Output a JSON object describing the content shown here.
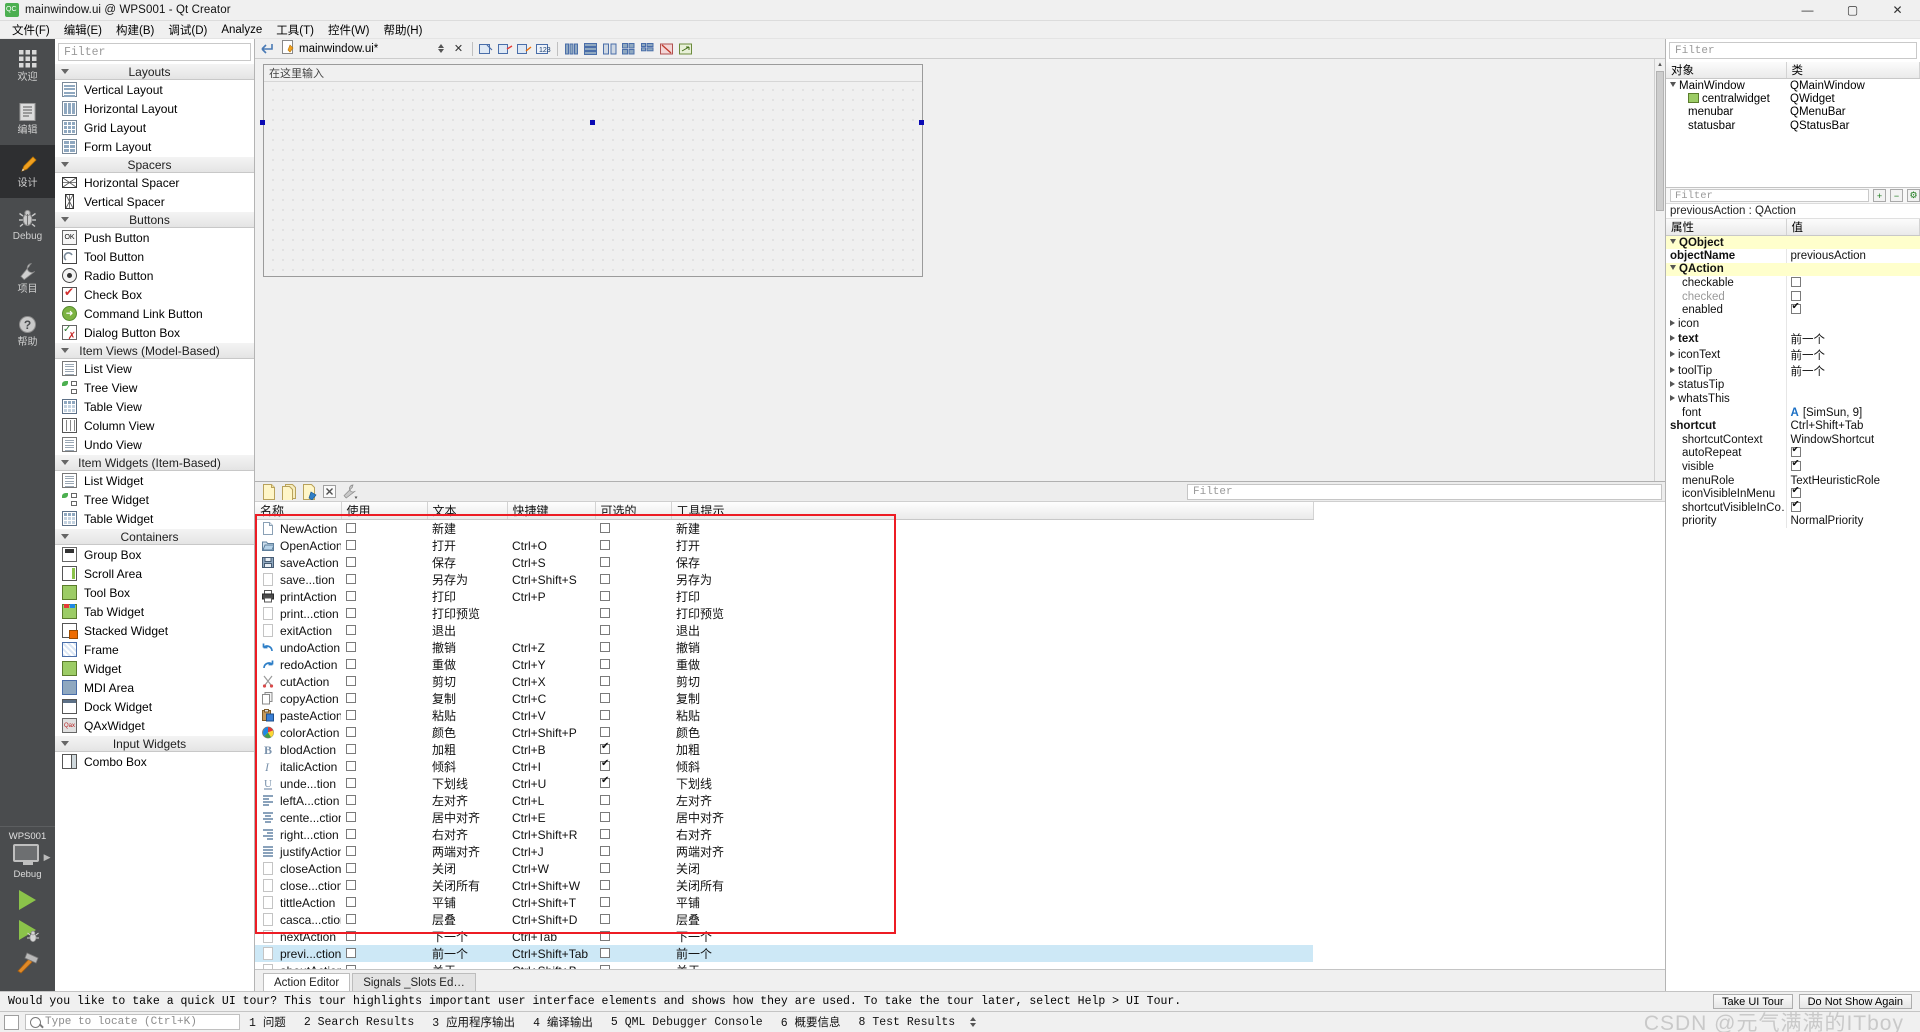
{
  "window": {
    "title": "mainwindow.ui @ WPS001 - Qt Creator",
    "app_icon": "qt-creator-icon",
    "minimize": "—",
    "maximize": "▢",
    "close": "✕"
  },
  "menubar": {
    "items": [
      {
        "label": "文件(F)",
        "name": "menu-file"
      },
      {
        "label": "编辑(E)",
        "name": "menu-edit"
      },
      {
        "label": "构建(B)",
        "name": "menu-build"
      },
      {
        "label": "调试(D)",
        "name": "menu-debug"
      },
      {
        "label": "Analyze",
        "name": "menu-analyze"
      },
      {
        "label": "工具(T)",
        "name": "menu-tools"
      },
      {
        "label": "控件(W)",
        "name": "menu-window"
      },
      {
        "label": "帮助(H)",
        "name": "menu-help"
      }
    ]
  },
  "modebar": {
    "modes": [
      {
        "label": "欢迎",
        "icon": "grid-icon",
        "active": false
      },
      {
        "label": "编辑",
        "icon": "document-icon",
        "active": false
      },
      {
        "label": "设计",
        "icon": "pencil-icon",
        "active": true
      },
      {
        "label": "Debug",
        "icon": "bug-icon",
        "active": false
      },
      {
        "label": "项目",
        "icon": "wrench-icon",
        "active": false
      },
      {
        "label": "帮助",
        "icon": "question-icon",
        "active": false
      }
    ],
    "kit": {
      "project_name": "WPS001",
      "build_config": "Debug",
      "monitor_icon": "desktop-icon"
    },
    "run_buttons": [
      {
        "name": "run-button",
        "icon": "play-icon"
      },
      {
        "name": "debug-button",
        "icon": "play-bug-icon"
      },
      {
        "name": "build-button",
        "icon": "hammer-icon"
      }
    ]
  },
  "widgetbox": {
    "filter_placeholder": "Filter",
    "groups": [
      {
        "name": "Layouts",
        "items": [
          {
            "label": "Vertical Layout",
            "icon": "vertical-layout-icon"
          },
          {
            "label": "Horizontal Layout",
            "icon": "horizontal-layout-icon"
          },
          {
            "label": "Grid Layout",
            "icon": "grid-layout-icon"
          },
          {
            "label": "Form Layout",
            "icon": "form-layout-icon"
          }
        ]
      },
      {
        "name": "Spacers",
        "items": [
          {
            "label": "Horizontal Spacer",
            "icon": "horizontal-spacer-icon"
          },
          {
            "label": "Vertical Spacer",
            "icon": "vertical-spacer-icon"
          }
        ]
      },
      {
        "name": "Buttons",
        "items": [
          {
            "label": "Push Button",
            "icon": "push-button-icon"
          },
          {
            "label": "Tool Button",
            "icon": "tool-button-icon"
          },
          {
            "label": "Radio Button",
            "icon": "radio-button-icon"
          },
          {
            "label": "Check Box",
            "icon": "check-box-icon"
          },
          {
            "label": "Command Link Button",
            "icon": "command-link-icon"
          },
          {
            "label": "Dialog Button Box",
            "icon": "dialog-button-box-icon"
          }
        ]
      },
      {
        "name": "Item Views (Model-Based)",
        "items": [
          {
            "label": "List View",
            "icon": "list-view-icon"
          },
          {
            "label": "Tree View",
            "icon": "tree-view-icon"
          },
          {
            "label": "Table View",
            "icon": "table-view-icon"
          },
          {
            "label": "Column View",
            "icon": "column-view-icon"
          },
          {
            "label": "Undo View",
            "icon": "undo-view-icon"
          }
        ]
      },
      {
        "name": "Item Widgets (Item-Based)",
        "items": [
          {
            "label": "List Widget",
            "icon": "list-widget-icon"
          },
          {
            "label": "Tree Widget",
            "icon": "tree-widget-icon"
          },
          {
            "label": "Table Widget",
            "icon": "table-widget-icon"
          }
        ]
      },
      {
        "name": "Containers",
        "items": [
          {
            "label": "Group Box",
            "icon": "group-box-icon"
          },
          {
            "label": "Scroll Area",
            "icon": "scroll-area-icon"
          },
          {
            "label": "Tool Box",
            "icon": "tool-box-icon"
          },
          {
            "label": "Tab Widget",
            "icon": "tab-widget-icon"
          },
          {
            "label": "Stacked Widget",
            "icon": "stacked-widget-icon"
          },
          {
            "label": "Frame",
            "icon": "frame-icon"
          },
          {
            "label": "Widget",
            "icon": "widget-icon"
          },
          {
            "label": "MDI Area",
            "icon": "mdi-area-icon"
          },
          {
            "label": "Dock Widget",
            "icon": "dock-widget-icon"
          },
          {
            "label": "QAxWidget",
            "icon": "qax-widget-icon"
          }
        ]
      },
      {
        "name": "Input Widgets",
        "items": [
          {
            "label": "Combo Box",
            "icon": "combo-box-icon"
          }
        ]
      }
    ]
  },
  "toolbar": {
    "file_name": "mainwindow.ui*",
    "file_icon": "ui-file-icon",
    "back_icon": "back-icon",
    "close_icon": "close-icon",
    "buttons": [
      {
        "name": "edit-widgets-button",
        "icon": "edit-widgets-icon"
      },
      {
        "name": "edit-signals-slots-button",
        "icon": "signals-slots-icon"
      },
      {
        "name": "edit-buddies-button",
        "icon": "buddies-icon"
      },
      {
        "name": "edit-tab-order-button",
        "icon": "tab-order-icon"
      },
      {
        "name": "layout-horizontally-button",
        "icon": "layout-h-icon"
      },
      {
        "name": "layout-vertically-button",
        "icon": "layout-v-icon"
      },
      {
        "name": "layout-splitter-h-button",
        "icon": "splitter-h-icon"
      },
      {
        "name": "layout-grid-button",
        "icon": "layout-grid-icon"
      },
      {
        "name": "layout-form-button",
        "icon": "layout-form-icon"
      },
      {
        "name": "break-layout-button",
        "icon": "break-layout-icon"
      },
      {
        "name": "adjust-size-button",
        "icon": "adjust-size-icon"
      }
    ]
  },
  "form": {
    "menu_placeholder": "在这里输入"
  },
  "action_editor": {
    "toolbar": [
      {
        "name": "new-action-button",
        "icon": "new-page-icon"
      },
      {
        "name": "new-action-copy-button",
        "icon": "copy-page-icon"
      },
      {
        "name": "edit-action-button",
        "icon": "edit-page-icon"
      },
      {
        "name": "delete-action-button",
        "icon": "delete-x-icon"
      },
      {
        "name": "view-options-button",
        "icon": "wrench-icon"
      }
    ],
    "filter_placeholder": "Filter",
    "columns": [
      "名称",
      "使用",
      "文本",
      "快捷键",
      "可选的",
      "工具提示"
    ],
    "rows": [
      {
        "name": "NewAction",
        "icon": "new-doc-icon",
        "used": false,
        "text": "新建",
        "shortcut": "",
        "checkable": false,
        "tooltip": "新建",
        "selected": false
      },
      {
        "name": "OpenAction",
        "icon": "open-folder-icon",
        "used": false,
        "text": "打开",
        "shortcut": "Ctrl+O",
        "checkable": false,
        "tooltip": "打开",
        "selected": false
      },
      {
        "name": "saveAction",
        "icon": "save-disk-icon",
        "used": false,
        "text": "保存",
        "shortcut": "Ctrl+S",
        "checkable": false,
        "tooltip": "保存",
        "selected": false
      },
      {
        "name": "save...tion",
        "icon": "blank-icon",
        "used": false,
        "text": "另存为",
        "shortcut": "Ctrl+Shift+S",
        "checkable": false,
        "tooltip": "另存为",
        "selected": false
      },
      {
        "name": "printAction",
        "icon": "printer-icon",
        "used": false,
        "text": "打印",
        "shortcut": "Ctrl+P",
        "checkable": false,
        "tooltip": "打印",
        "selected": false
      },
      {
        "name": "print...ction",
        "icon": "blank-icon",
        "used": false,
        "text": "打印预览",
        "shortcut": "",
        "checkable": false,
        "tooltip": "打印预览",
        "selected": false
      },
      {
        "name": "exitAction",
        "icon": "blank-icon",
        "used": false,
        "text": "退出",
        "shortcut": "",
        "checkable": false,
        "tooltip": "退出",
        "selected": false
      },
      {
        "name": "undoAction",
        "icon": "undo-arrow-icon",
        "used": false,
        "text": "撤销",
        "shortcut": "Ctrl+Z",
        "checkable": false,
        "tooltip": "撤销",
        "selected": false
      },
      {
        "name": "redoAction",
        "icon": "redo-arrow-icon",
        "used": false,
        "text": "重做",
        "shortcut": "Ctrl+Y",
        "checkable": false,
        "tooltip": "重做",
        "selected": false
      },
      {
        "name": "cutAction",
        "icon": "scissors-icon",
        "used": false,
        "text": "剪切",
        "shortcut": "Ctrl+X",
        "checkable": false,
        "tooltip": "剪切",
        "selected": false
      },
      {
        "name": "copyAction",
        "icon": "copy-icon",
        "used": false,
        "text": "复制",
        "shortcut": "Ctrl+C",
        "checkable": false,
        "tooltip": "复制",
        "selected": false
      },
      {
        "name": "pasteAction",
        "icon": "paste-icon",
        "used": false,
        "text": "粘贴",
        "shortcut": "Ctrl+V",
        "checkable": false,
        "tooltip": "粘贴",
        "selected": false
      },
      {
        "name": "colorAction",
        "icon": "color-wheel-icon",
        "used": false,
        "text": "颜色",
        "shortcut": "Ctrl+Shift+P",
        "checkable": false,
        "tooltip": "颜色",
        "selected": false
      },
      {
        "name": "blodAction",
        "icon": "bold-b-icon",
        "used": false,
        "text": "加粗",
        "shortcut": "Ctrl+B",
        "checkable": true,
        "tooltip": "加粗",
        "selected": false
      },
      {
        "name": "italicAction",
        "icon": "italic-i-icon",
        "used": false,
        "text": "倾斜",
        "shortcut": "Ctrl+I",
        "checkable": true,
        "tooltip": "倾斜",
        "selected": false
      },
      {
        "name": "unde...tion",
        "icon": "underline-u-icon",
        "used": false,
        "text": "下划线",
        "shortcut": "Ctrl+U",
        "checkable": true,
        "tooltip": "下划线",
        "selected": false
      },
      {
        "name": "leftA...ction",
        "icon": "align-left-icon",
        "used": false,
        "text": "左对齐",
        "shortcut": "Ctrl+L",
        "checkable": false,
        "tooltip": "左对齐",
        "selected": false
      },
      {
        "name": "cente...ction",
        "icon": "align-center-icon",
        "used": false,
        "text": "居中对齐",
        "shortcut": "Ctrl+E",
        "checkable": false,
        "tooltip": "居中对齐",
        "selected": false
      },
      {
        "name": "right...ction",
        "icon": "align-right-icon",
        "used": false,
        "text": "右对齐",
        "shortcut": "Ctrl+Shift+R",
        "checkable": false,
        "tooltip": "右对齐",
        "selected": false
      },
      {
        "name": "justifyAction",
        "icon": "align-justify-icon",
        "used": false,
        "text": "两端对齐",
        "shortcut": "Ctrl+J",
        "checkable": false,
        "tooltip": "两端对齐",
        "selected": false
      },
      {
        "name": "closeAction",
        "icon": "blank-icon",
        "used": false,
        "text": "关闭",
        "shortcut": "Ctrl+W",
        "checkable": false,
        "tooltip": "关闭",
        "selected": false
      },
      {
        "name": "close...ction",
        "icon": "blank-icon",
        "used": false,
        "text": "关闭所有",
        "shortcut": "Ctrl+Shift+W",
        "checkable": false,
        "tooltip": "关闭所有",
        "selected": false
      },
      {
        "name": "tittleAction",
        "icon": "blank-icon",
        "used": false,
        "text": "平铺",
        "shortcut": "Ctrl+Shift+T",
        "checkable": false,
        "tooltip": "平铺",
        "selected": false
      },
      {
        "name": "casca...ction",
        "icon": "blank-icon",
        "used": false,
        "text": "层叠",
        "shortcut": "Ctrl+Shift+D",
        "checkable": false,
        "tooltip": "层叠",
        "selected": false
      },
      {
        "name": "nextAction",
        "icon": "blank-icon",
        "used": false,
        "text": "下一个",
        "shortcut": "Ctrl+Tab",
        "checkable": false,
        "tooltip": "下一个",
        "selected": false
      },
      {
        "name": "previ...ction",
        "icon": "blank-icon",
        "used": false,
        "text": "前一个",
        "shortcut": "Ctrl+Shift+Tab",
        "checkable": false,
        "tooltip": "前一个",
        "selected": true
      },
      {
        "name": "aboutAction",
        "icon": "blank-icon",
        "used": false,
        "text": "关于",
        "shortcut": "Ctrl+Shift+B",
        "checkable": false,
        "tooltip": "关于",
        "selected": false
      }
    ],
    "tabs": [
      {
        "label": "Action Editor",
        "active": true
      },
      {
        "label": "Signals _Slots Ed…",
        "active": false
      }
    ]
  },
  "object_inspector": {
    "filter_placeholder": "Filter",
    "columns": [
      "对象",
      "类"
    ],
    "rows": [
      {
        "object": "MainWindow",
        "class": "QMainWindow",
        "indent": 0,
        "expander": "down",
        "icon": ""
      },
      {
        "object": "centralwidget",
        "class": "QWidget",
        "indent": 1,
        "expander": "",
        "icon": "widget-icon"
      },
      {
        "object": "menubar",
        "class": "QMenuBar",
        "indent": 1,
        "expander": "",
        "icon": ""
      },
      {
        "object": "statusbar",
        "class": "QStatusBar",
        "indent": 1,
        "expander": "",
        "icon": ""
      }
    ]
  },
  "property_editor": {
    "filter_placeholder": "Filter",
    "add_button": "+",
    "remove_button": "−",
    "config_button": "⚙",
    "subject": "previousAction : QAction",
    "columns": [
      "属性",
      "值"
    ],
    "rows": [
      {
        "key": "QObject",
        "value": "",
        "type": "group"
      },
      {
        "key": "objectName",
        "value": "previousAction",
        "type": "bold"
      },
      {
        "key": "QAction",
        "value": "",
        "type": "group"
      },
      {
        "key": "checkable",
        "value": "",
        "type": "check",
        "checked": false,
        "expander": ""
      },
      {
        "key": "checked",
        "value": "",
        "type": "check",
        "checked": false,
        "dim": true
      },
      {
        "key": "enabled",
        "value": "",
        "type": "check",
        "checked": true
      },
      {
        "key": "icon",
        "value": "",
        "type": "expand"
      },
      {
        "key": "text",
        "value": "前一个",
        "type": "expand-bold"
      },
      {
        "key": "iconText",
        "value": "前一个",
        "type": "expand"
      },
      {
        "key": "toolTip",
        "value": "前一个",
        "type": "expand"
      },
      {
        "key": "statusTip",
        "value": "",
        "type": "expand"
      },
      {
        "key": "whatsThis",
        "value": "",
        "type": "expand"
      },
      {
        "key": "font",
        "value": "[SimSun, 9]",
        "type": "font"
      },
      {
        "key": "shortcut",
        "value": "Ctrl+Shift+Tab",
        "type": "bold"
      },
      {
        "key": "shortcutContext",
        "value": "WindowShortcut",
        "type": "plain"
      },
      {
        "key": "autoRepeat",
        "value": "",
        "type": "check",
        "checked": true
      },
      {
        "key": "visible",
        "value": "",
        "type": "check",
        "checked": true
      },
      {
        "key": "menuRole",
        "value": "TextHeuristicRole",
        "type": "plain"
      },
      {
        "key": "iconVisibleInMenu",
        "value": "",
        "type": "check",
        "checked": true
      },
      {
        "key": "shortcutVisibleInCo…",
        "value": "",
        "type": "check",
        "checked": true
      },
      {
        "key": "priority",
        "value": "NormalPriority",
        "type": "plain"
      }
    ]
  },
  "tour_bar": {
    "message": "Would you like to take a quick UI tour? This tour highlights important user interface elements and shows how they are used. To take the tour later, select Help > UI Tour.",
    "primary_button": "Take UI Tour",
    "secondary_button": "Do Not Show Again"
  },
  "statusbar": {
    "locator_placeholder": "Type to locate (Ctrl+K)",
    "panels": [
      {
        "num": "1",
        "label": "问题"
      },
      {
        "num": "2",
        "label": "Search Results"
      },
      {
        "num": "3",
        "label": "应用程序输出"
      },
      {
        "num": "4",
        "label": "编译输出"
      },
      {
        "num": "5",
        "label": "QML Debugger Console"
      },
      {
        "num": "6",
        "label": "概要信息"
      },
      {
        "num": "8",
        "label": "Test Results"
      }
    ],
    "watermark": "CSDN @元气满满的ITboy"
  },
  "colors": {
    "selection": "#cde8f6",
    "red_annotation": "#ed1c24",
    "group_row": "#ffffcc",
    "mode_active": "#2e2f31",
    "modebar_bg": "#4a4c4e"
  }
}
